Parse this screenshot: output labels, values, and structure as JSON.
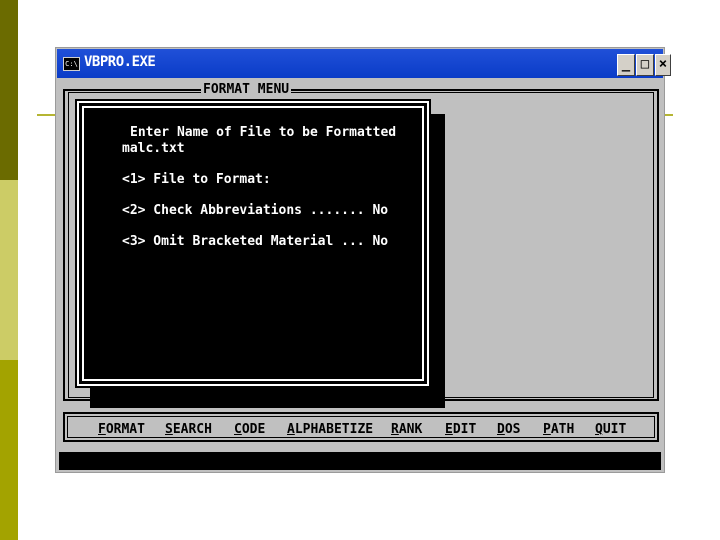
{
  "window": {
    "title": "VBPRO.EXE",
    "icon_label": "C:\\",
    "buttons": {
      "minimize": "_",
      "restore": "□",
      "close": "×"
    }
  },
  "frame": {
    "label": "FORMAT MENU"
  },
  "panel": {
    "prompt": "Enter Name of File to be Formatted",
    "filename": "malc.txt",
    "options": [
      "<1> File to Format:",
      "<2> Check Abbreviations ....... No",
      "<3> Omit Bracketed Material ... No"
    ]
  },
  "menu": [
    {
      "hotkey": "F",
      "rest": "ORMAT"
    },
    {
      "hotkey": "S",
      "rest": "EARCH"
    },
    {
      "hotkey": "C",
      "rest": "ODE"
    },
    {
      "hotkey": "A",
      "rest": "LPHABETIZE"
    },
    {
      "hotkey": "R",
      "rest": "ANK"
    },
    {
      "hotkey": "E",
      "rest": "DIT"
    },
    {
      "hotkey": "D",
      "rest": "OS"
    },
    {
      "hotkey": "P",
      "rest": "ATH"
    },
    {
      "hotkey": "Q",
      "rest": "UIT"
    }
  ],
  "colors": {
    "titlebar": "#0a3cc8",
    "console_bg": "#c0c0c0",
    "panel_bg": "#000000",
    "panel_text": "#ffffff"
  }
}
